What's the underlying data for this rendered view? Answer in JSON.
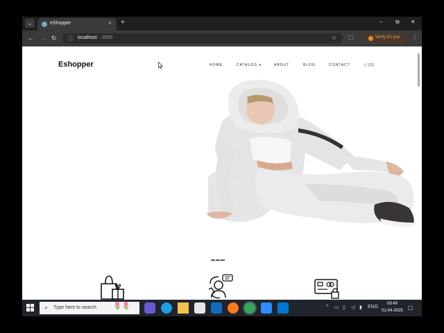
{
  "browser": {
    "tab_title": "eShopper",
    "tab_close": "×",
    "new_tab": "+",
    "url_host": "localhost",
    "url_port": ":3000",
    "verify_label": "Verify it's you",
    "window_min": "–",
    "window_max": "⧉",
    "window_close": "✕"
  },
  "site": {
    "brand": "Eshopper",
    "nav": {
      "home": "HOME",
      "catalog": "CATALOG ▾",
      "about": "ABOUT",
      "blog": "BLOG",
      "contact": "CONTACT",
      "cart": "🛒[0]"
    },
    "carousel_slides": 3
  },
  "taskbar": {
    "search_placeholder": "Type here to search",
    "language": "ENG",
    "time": "09:49",
    "date": "01-04-2025"
  },
  "icons": [
    "tab-search-icon",
    "back-icon",
    "forward-icon",
    "reload-icon",
    "info-icon",
    "star-icon",
    "extensions-icon",
    "menu-icon",
    "cursor-icon",
    "shopping-bag-gift-icon",
    "support-phone-icon",
    "payment-card-lock-icon",
    "windows-start-icon",
    "search-icon"
  ],
  "colors": {
    "chrome_dark": "#1f1f1f",
    "chrome_toolbar": "#3a3a3a",
    "taskbar": "#20252d",
    "verify_accent": "#e8892b"
  }
}
